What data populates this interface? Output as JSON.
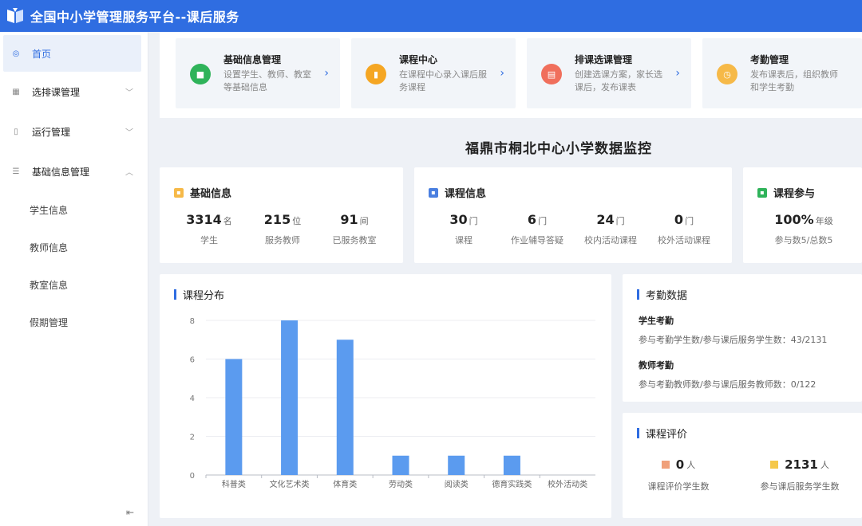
{
  "app": {
    "title": "全国中小学管理服务平台--课后服务"
  },
  "sidebar": {
    "items": [
      {
        "label": "首页"
      },
      {
        "label": "选排课管理"
      },
      {
        "label": "运行管理"
      },
      {
        "label": "基础信息管理"
      }
    ],
    "subitems": [
      {
        "label": "学生信息"
      },
      {
        "label": "教师信息"
      },
      {
        "label": "教室信息"
      },
      {
        "label": "假期管理"
      }
    ]
  },
  "quick": [
    {
      "title": "基础信息管理",
      "desc": "设置学生、教师、教室等基础信息",
      "color": "#2fb35a"
    },
    {
      "title": "课程中心",
      "desc": "在课程中心录入课后服务课程",
      "color": "#f5a623"
    },
    {
      "title": "排课选课管理",
      "desc": "创建选课方案，家长选课后，发布课表",
      "color": "#f06f5c"
    },
    {
      "title": "考勤管理",
      "desc": "发布课表后，组织教师和学生考勤",
      "color": "#f6b948"
    }
  ],
  "monitor_title": "福鼎市桐北中心小学数据监控",
  "basic": {
    "title": "基础信息",
    "stats": [
      {
        "num": "3314",
        "unit": "名",
        "label": "学生"
      },
      {
        "num": "215",
        "unit": "位",
        "label": "服务教师"
      },
      {
        "num": "91",
        "unit": "间",
        "label": "已服务教室"
      }
    ]
  },
  "course": {
    "title": "课程信息",
    "stats": [
      {
        "num": "30",
        "unit": "门",
        "label": "课程"
      },
      {
        "num": "6",
        "unit": "门",
        "label": "作业辅导答疑"
      },
      {
        "num": "24",
        "unit": "门",
        "label": "校内活动课程"
      },
      {
        "num": "0",
        "unit": "门",
        "label": "校外活动课程"
      }
    ]
  },
  "participation": {
    "title": "课程参与",
    "num": "100%",
    "unit": "年级",
    "label": "参与数5/总数5"
  },
  "chart_data": {
    "type": "bar",
    "title": "课程分布",
    "categories": [
      "科普类",
      "文化艺术类",
      "体育类",
      "劳动类",
      "阅读类",
      "德育实践类",
      "校外活动类"
    ],
    "values": [
      6,
      8,
      7,
      1,
      1,
      1,
      0
    ],
    "ylim": [
      0,
      8
    ],
    "yticks": [
      "0",
      "2",
      "4",
      "6",
      "8"
    ],
    "color": "#5b9bef",
    "grid": true
  },
  "attendance": {
    "title": "考勤数据",
    "student_title": "学生考勤",
    "student_line": "参与考勤学生数/参与课后服务学生数：43/2131",
    "teacher_title": "教师考勤",
    "teacher_line": "参与考勤教师数/参与课后服务教师数：0/122"
  },
  "evaluation": {
    "title": "课程评价",
    "items": [
      {
        "num": "0",
        "unit": "人",
        "label": "课程评价学生数",
        "color": "#f0a07a"
      },
      {
        "num": "2131",
        "unit": "人",
        "label": "参与课后服务学生数",
        "color": "#f5c84a"
      }
    ]
  }
}
